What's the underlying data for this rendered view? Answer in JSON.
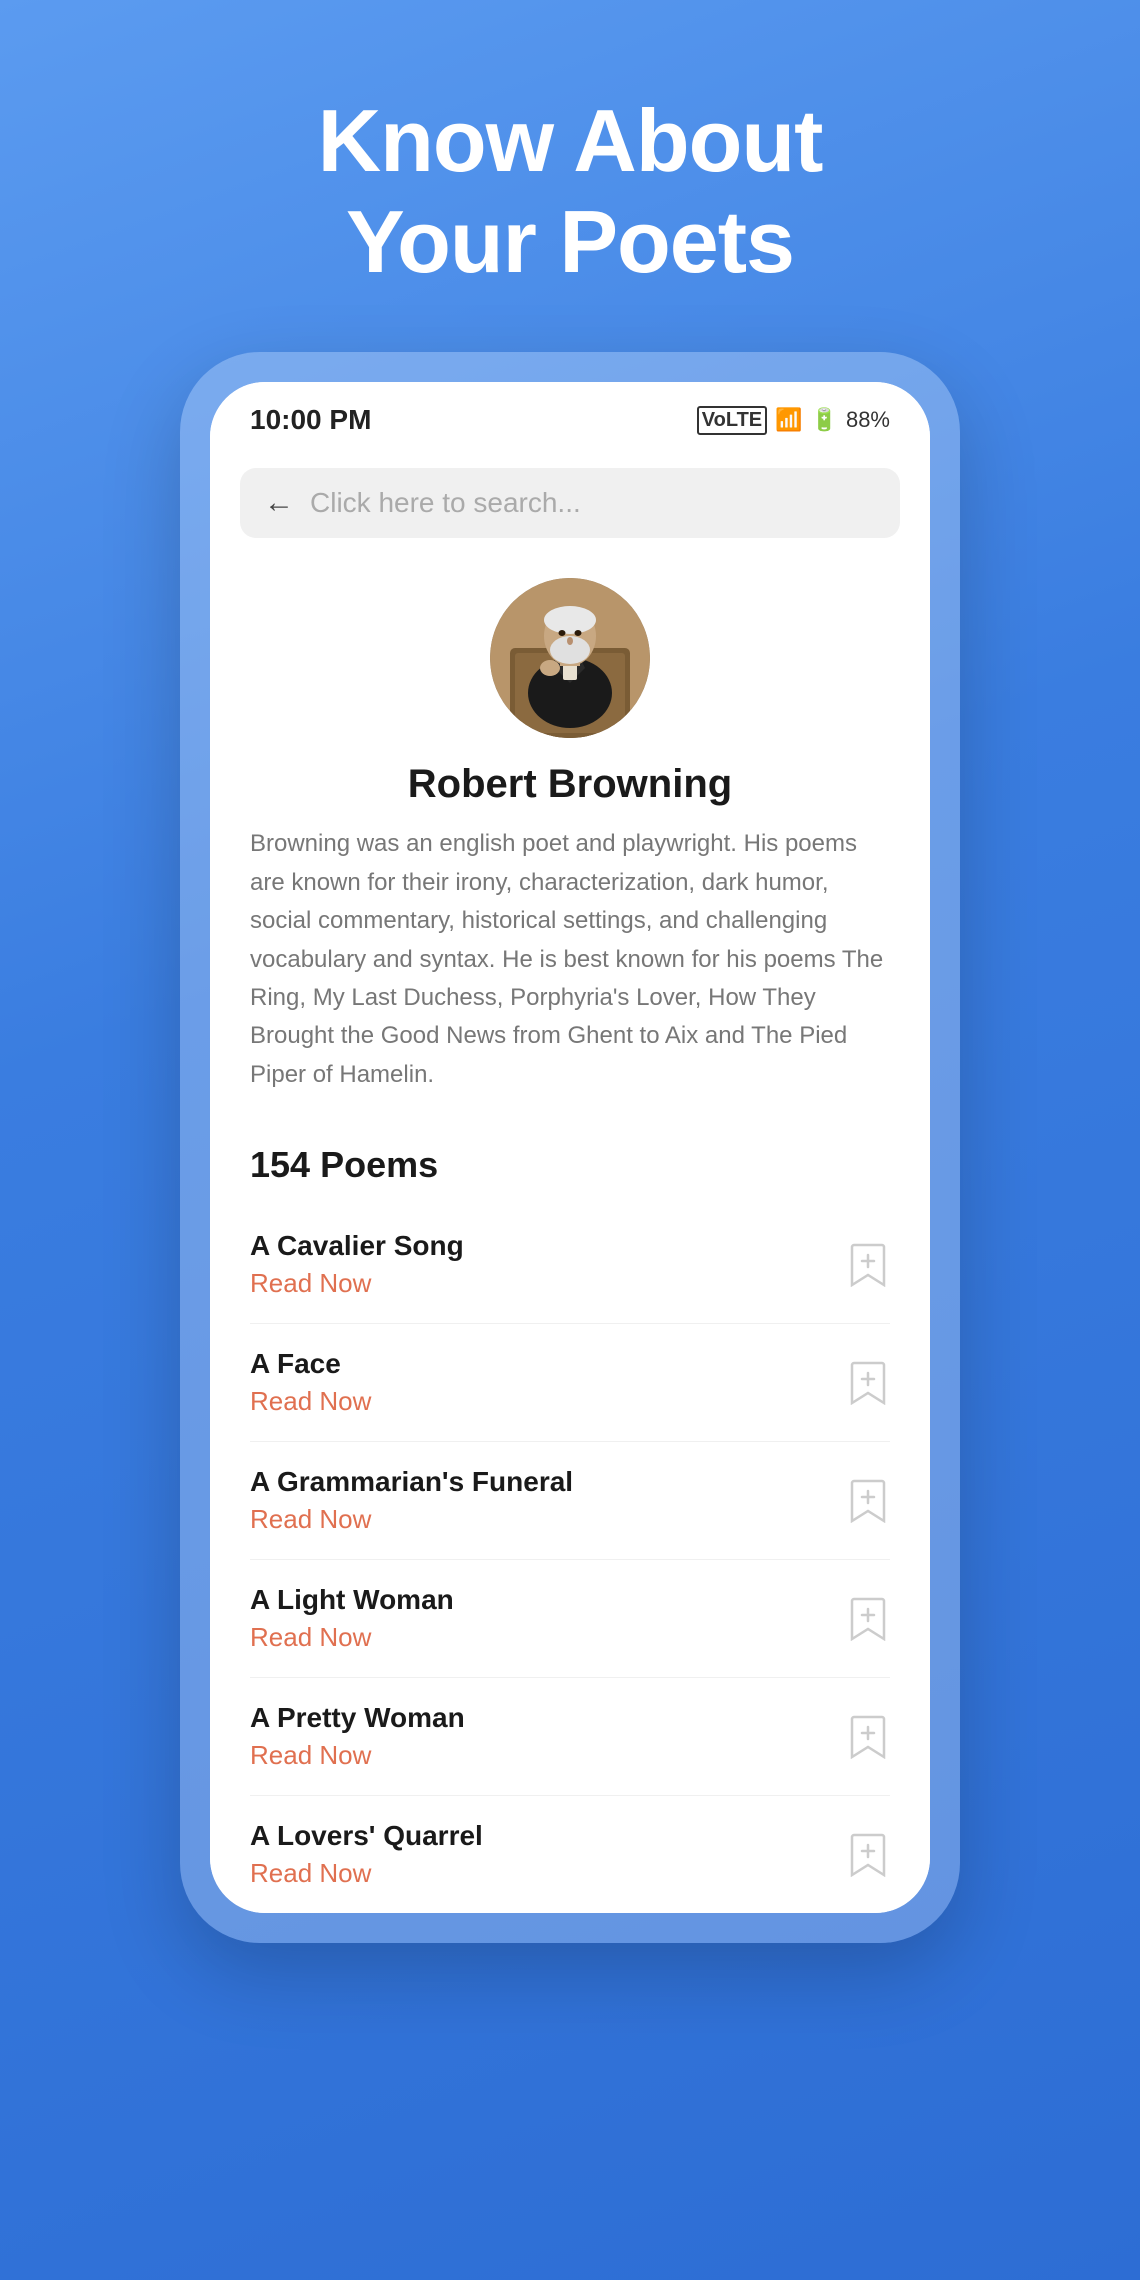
{
  "header": {
    "line1": "Know About",
    "line2": "Your Poets"
  },
  "statusBar": {
    "time": "10:00 PM",
    "battery": "88%",
    "signal": "4G"
  },
  "searchBar": {
    "placeholder": "Click here to search...",
    "backArrow": "←"
  },
  "poet": {
    "name": "Robert Browning",
    "bio": "Browning was an english poet and playwright. His poems are known for their irony, characterization, dark humor, social commentary, historical settings, and challenging vocabulary and syntax. He is best known for his poems The Ring, My Last Duchess, Porphyria's Lover, How They Brought the Good News from Ghent to Aix and The Pied Piper of Hamelin.",
    "poemsCount": "154 Poems"
  },
  "poems": [
    {
      "title": "A Cavalier Song",
      "readLabel": "Read Now"
    },
    {
      "title": "A Face",
      "readLabel": "Read Now"
    },
    {
      "title": "A Grammarian's Funeral",
      "readLabel": "Read Now"
    },
    {
      "title": "A Light Woman",
      "readLabel": "Read Now"
    },
    {
      "title": "A Pretty Woman",
      "readLabel": "Read Now"
    },
    {
      "title": "A Lovers' Quarrel",
      "readLabel": "Read Now"
    }
  ]
}
